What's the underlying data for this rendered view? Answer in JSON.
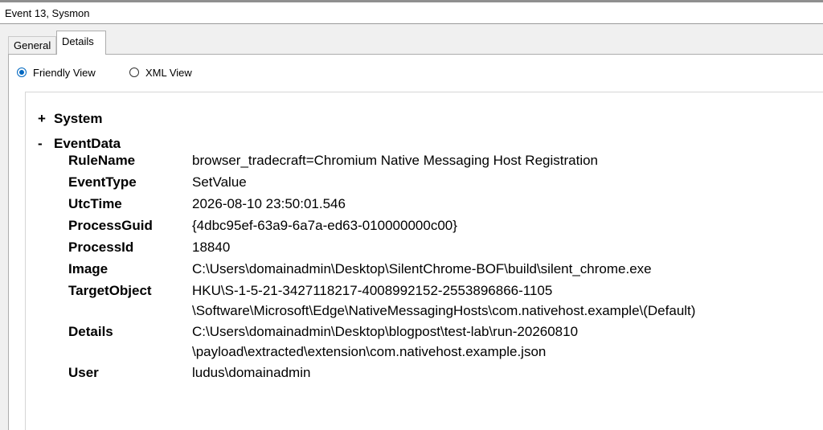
{
  "window": {
    "title": "Event 13, Sysmon"
  },
  "tabs": [
    {
      "label": "General",
      "selected": false
    },
    {
      "label": "Details",
      "selected": true
    }
  ],
  "view_options": {
    "friendly": {
      "label": "Friendly View",
      "selected": true
    },
    "xml": {
      "label": "XML View",
      "selected": false
    }
  },
  "sections": {
    "system": {
      "toggle": "+",
      "label": "System"
    },
    "eventdata": {
      "toggle": "-",
      "label": "EventData"
    }
  },
  "fields": [
    {
      "name": "RuleName",
      "lines": [
        "browser_tradecraft=Chromium Native Messaging Host Registration"
      ]
    },
    {
      "name": "EventType",
      "lines": [
        "SetValue"
      ]
    },
    {
      "name": "UtcTime",
      "lines": [
        "2026-08-10 23:50:01.546"
      ]
    },
    {
      "name": "ProcessGuid",
      "lines": [
        "{4dbc95ef-63a9-6a7a-ed63-010000000c00}"
      ]
    },
    {
      "name": "ProcessId",
      "lines": [
        "18840"
      ]
    },
    {
      "name": "Image",
      "lines": [
        "C:\\Users\\domainadmin\\Desktop\\SilentChrome-BOF\\build\\silent_chrome.exe"
      ]
    },
    {
      "name": "TargetObject",
      "lines": [
        "HKU\\S-1-5-21-3427118217-4008992152-2553896866-1105",
        "\\Software\\Microsoft\\Edge\\NativeMessagingHosts\\com.nativehost.example\\(Default)"
      ]
    },
    {
      "name": "Details",
      "lines": [
        "C:\\Users\\domainadmin\\Desktop\\blogpost\\test-lab\\run-20260810",
        "\\payload\\extracted\\extension\\com.nativehost.example.json"
      ]
    },
    {
      "name": "User",
      "lines": [
        "ludus\\domainadmin"
      ]
    }
  ],
  "colors": {
    "accent": "#0067c0",
    "chrome_bg": "#f0f0f0",
    "panel_bg": "#ffffff"
  }
}
